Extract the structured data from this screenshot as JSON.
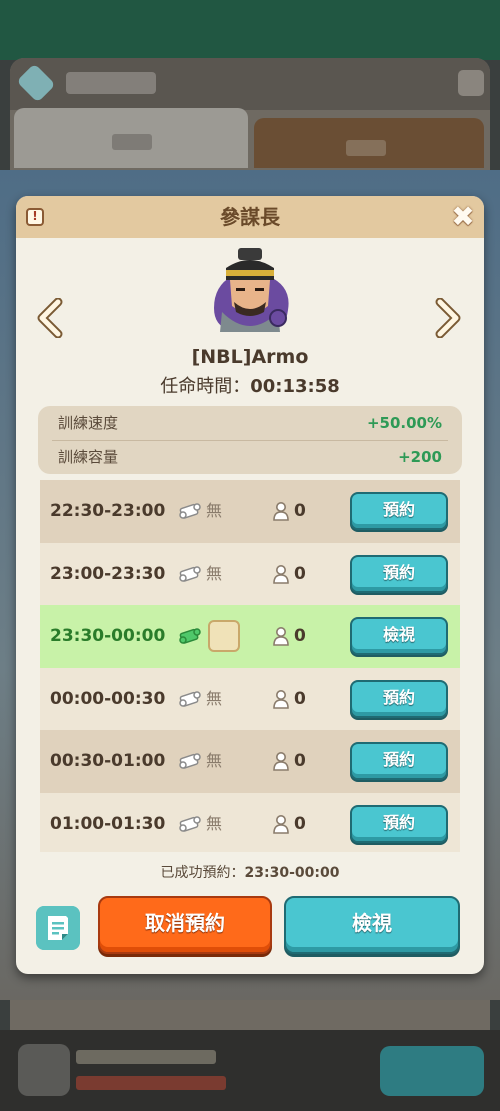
{
  "dialog": {
    "title": "參謀長",
    "player_name": "[NBL]Armo",
    "term_label": "任命時間：",
    "term_value": "00:13:58"
  },
  "stats": [
    {
      "label": "訓練速度",
      "value": "+50.00%"
    },
    {
      "label": "訓練容量",
      "value": "+200"
    }
  ],
  "slots": [
    {
      "time": "22:30-23:00",
      "item": "無",
      "count": "0",
      "button": "預約",
      "state": "normal"
    },
    {
      "time": "23:00-23:30",
      "item": "無",
      "count": "0",
      "button": "預約",
      "state": "normal"
    },
    {
      "time": "23:30-00:00",
      "item": "",
      "count": "0",
      "button": "檢視",
      "state": "selected"
    },
    {
      "time": "00:00-00:30",
      "item": "無",
      "count": "0",
      "button": "預約",
      "state": "normal"
    },
    {
      "time": "00:30-01:00",
      "item": "無",
      "count": "0",
      "button": "預約",
      "state": "normal"
    },
    {
      "time": "01:00-01:30",
      "item": "無",
      "count": "0",
      "button": "預約",
      "state": "normal"
    }
  ],
  "footer": {
    "note_label": "已成功預約：",
    "note_time": "23:30-00:00",
    "cancel_label": "取消預約",
    "view_label": "檢視"
  },
  "colors": {
    "accent_teal": "#4ac6d0",
    "cancel_orange": "#ff6a1a",
    "stat_green": "#2e9a56",
    "selected_row": "#c8f2a8"
  }
}
